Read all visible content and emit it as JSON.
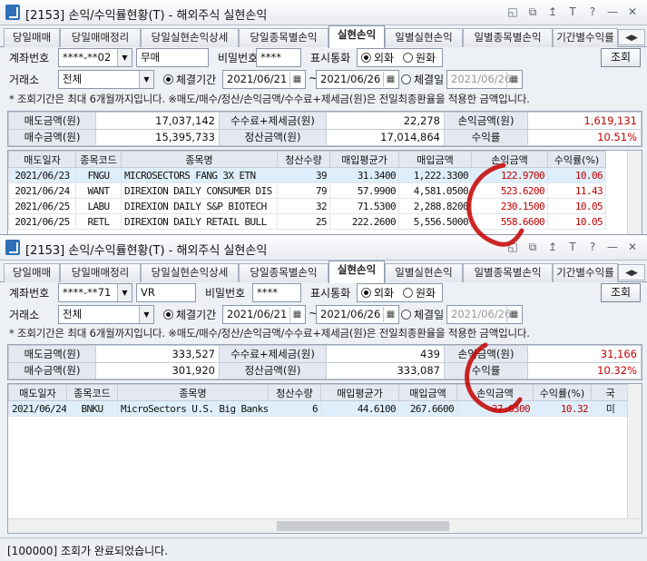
{
  "win1": {
    "title": "[2153] 손익/수익률현황(T) - 해외주식 실현손익",
    "controls": [
      "◱",
      "⧉",
      "↥",
      "T",
      "?",
      "—",
      "✕"
    ],
    "tabs": [
      "당일매매",
      "당일매매정리",
      "당일실현손익상세",
      "당일종목별손익",
      "실현손익",
      "일별실현손익",
      "일별종목별손익",
      "기간별수익률"
    ],
    "account_label": "계좌번호",
    "account": "****-**02",
    "account_name": "무매",
    "password_label": "비밀번호",
    "password": "****",
    "display_currency_label": "표시통화",
    "won_foreign": "외화",
    "won_krw": "원화",
    "exchange_label": "거래소",
    "exchange": "전체",
    "settle_period": "체결기간",
    "date_from": "2021/06/21",
    "tilde": "~",
    "date_to": "2021/06/26",
    "settle_day": "체결일",
    "settle_day_value": "2021/06/26",
    "search": "조회",
    "notice": "* 조회기간은 최대 6개월까지입니다.  ※매도/매수/정산/손익금액/수수료+제세금(원)은 전일최종환율을 적용한 금액입니다.",
    "summary": {
      "sell_label": "매도금액(원)",
      "sell": "17,037,142",
      "fee_label": "수수료+제세금(원)",
      "fee": "22,278",
      "pnl_label": "손익금액(원)",
      "pnl": "1,619,131",
      "buy_label": "매수금액(원)",
      "buy": "15,395,733",
      "settle_label": "정산금액(원)",
      "settle": "17,014,864",
      "rate_label": "수익률",
      "rate": "10.51%"
    },
    "columns": [
      "매도일자",
      "종목코드",
      "종목명",
      "청산수량",
      "매입평균가",
      "매입금액",
      "손익금액",
      "수익률(%)"
    ],
    "rows": [
      [
        "2021/06/23",
        "FNGU",
        "MICROSECTORS FANG 3X ETN",
        "39",
        "31.3400",
        "1,222.3300",
        "122.9700",
        "10.06"
      ],
      [
        "2021/06/24",
        "WANT",
        "DIREXION DAILY CONSUMER DIS",
        "79",
        "57.9900",
        "4,581.0500",
        "523.6200",
        "11.43"
      ],
      [
        "2021/06/25",
        "LABU",
        "DIREXION DAILY S&P BIOTECH",
        "32",
        "71.5300",
        "2,288.8200",
        "230.1500",
        "10.05"
      ],
      [
        "2021/06/25",
        "RETL",
        "DIREXION DAILY RETAIL BULL",
        "25",
        "222.2600",
        "5,556.5000",
        "558.6600",
        "10.05"
      ]
    ]
  },
  "win2": {
    "title": "[2153] 손익/수익률현황(T) - 해외주식 실현손익",
    "controls": [
      "◱",
      "⧉",
      "↥",
      "T",
      "?",
      "—",
      "✕"
    ],
    "tabs": [
      "당일매매",
      "당일매매정리",
      "당일실현손익상세",
      "당일종목별손익",
      "실현손익",
      "일별실현손익",
      "일별종목별손익",
      "기간별수익률"
    ],
    "account_label": "계좌번호",
    "account": "****-**71",
    "account_name": "VR",
    "password_label": "비밀번호",
    "password": "****",
    "display_currency_label": "표시통화",
    "won_foreign": "외화",
    "won_krw": "원화",
    "exchange_label": "거래소",
    "exchange": "전체",
    "settle_period": "체결기간",
    "date_from": "2021/06/21",
    "tilde": "~",
    "date_to": "2021/06/26",
    "settle_day": "체결일",
    "settle_day_value": "2021/06/26",
    "search": "조회",
    "notice": "* 조회기간은 최대 6개월까지입니다.  ※매도/매수/정산/손익금액/수수료+제세금(원)은 전일최종환율을 적용한 금액입니다.",
    "summary": {
      "sell_label": "매도금액(원)",
      "sell": "333,527",
      "fee_label": "수수료+제세금(원)",
      "fee": "439",
      "pnl_label": "손익금액(원)",
      "pnl": "31,166",
      "buy_label": "매수금액(원)",
      "buy": "301,920",
      "settle_label": "정산금액(원)",
      "settle": "333,087",
      "rate_label": "수익률",
      "rate": "10.32%"
    },
    "columns": [
      "매도일자",
      "종목코드",
      "종목명",
      "청산수량",
      "매입평균가",
      "매입금액",
      "손익금액",
      "수익률(%)",
      "국"
    ],
    "rows": [
      [
        "2021/06/24",
        "BNKU",
        "MicroSectors U.S. Big Banks",
        "6",
        "44.6100",
        "267.6600",
        "27.6300",
        "10.32",
        "미"
      ]
    ],
    "status": "[100000] 조회가 완료되었습니다."
  },
  "colors": {
    "accent": "#c00000",
    "header": "#e4e9f1",
    "selected_row": "#dfeefb"
  }
}
